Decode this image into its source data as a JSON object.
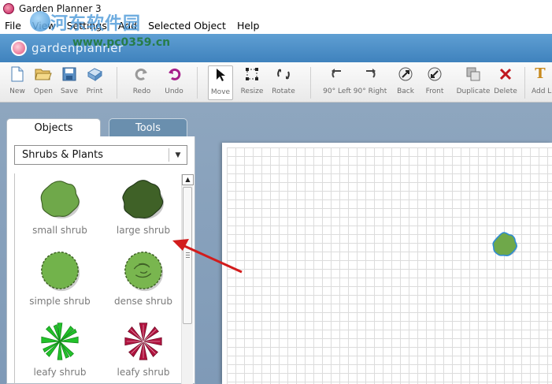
{
  "window": {
    "title": "Garden Planner 3"
  },
  "menu": [
    "File",
    "View",
    "Settings",
    "Add",
    "Selected Object",
    "Help"
  ],
  "watermark": {
    "text": "河东软件园",
    "url": "www.pc0359.cn"
  },
  "brand": {
    "text": "gardenplanner"
  },
  "toolbar": {
    "items": [
      {
        "id": "new",
        "label": "New",
        "icon": "new-document-icon"
      },
      {
        "id": "open",
        "label": "Open",
        "icon": "folder-open-icon"
      },
      {
        "id": "save",
        "label": "Save",
        "icon": "floppy-disk-icon"
      },
      {
        "id": "print",
        "label": "Print",
        "icon": "printer-icon"
      },
      {
        "id": "redo",
        "label": "Redo",
        "icon": "redo-icon"
      },
      {
        "id": "undo",
        "label": "Undo",
        "icon": "undo-icon"
      },
      {
        "id": "move",
        "label": "Move",
        "icon": "cursor-arrow-icon",
        "active": true
      },
      {
        "id": "resize",
        "label": "Resize",
        "icon": "resize-icon"
      },
      {
        "id": "rotate",
        "label": "Rotate",
        "icon": "rotate-icon"
      },
      {
        "id": "rot-left",
        "label": "90° Left",
        "icon": "rotate-left-icon"
      },
      {
        "id": "rot-right",
        "label": "90° Right",
        "icon": "rotate-right-icon"
      },
      {
        "id": "back",
        "label": "Back",
        "icon": "send-back-icon"
      },
      {
        "id": "front",
        "label": "Front",
        "icon": "bring-front-icon"
      },
      {
        "id": "duplicate",
        "label": "Duplicate",
        "icon": "duplicate-icon"
      },
      {
        "id": "delete",
        "label": "Delete",
        "icon": "delete-x-icon"
      },
      {
        "id": "add-label",
        "label": "Add L",
        "icon": "text-label-icon"
      }
    ]
  },
  "tabs": {
    "objects": "Objects",
    "tools": "Tools"
  },
  "category": {
    "selected": "Shrubs & Plants"
  },
  "objects": [
    {
      "label": "small shrub"
    },
    {
      "label": "large shrub"
    },
    {
      "label": "simple shrub"
    },
    {
      "label": "dense shrub"
    },
    {
      "label": "leafy shrub"
    },
    {
      "label": "leafy shrub"
    }
  ],
  "colors": {
    "brand_bar": "#4a8bc4",
    "shrub_green": "#6fa84a",
    "shrub_dark": "#3f6127",
    "leafy_green": "#22c22a",
    "leafy_red": "#b0123e",
    "arrow_red": "#d21c1c",
    "workspace": "#87a1bc"
  }
}
